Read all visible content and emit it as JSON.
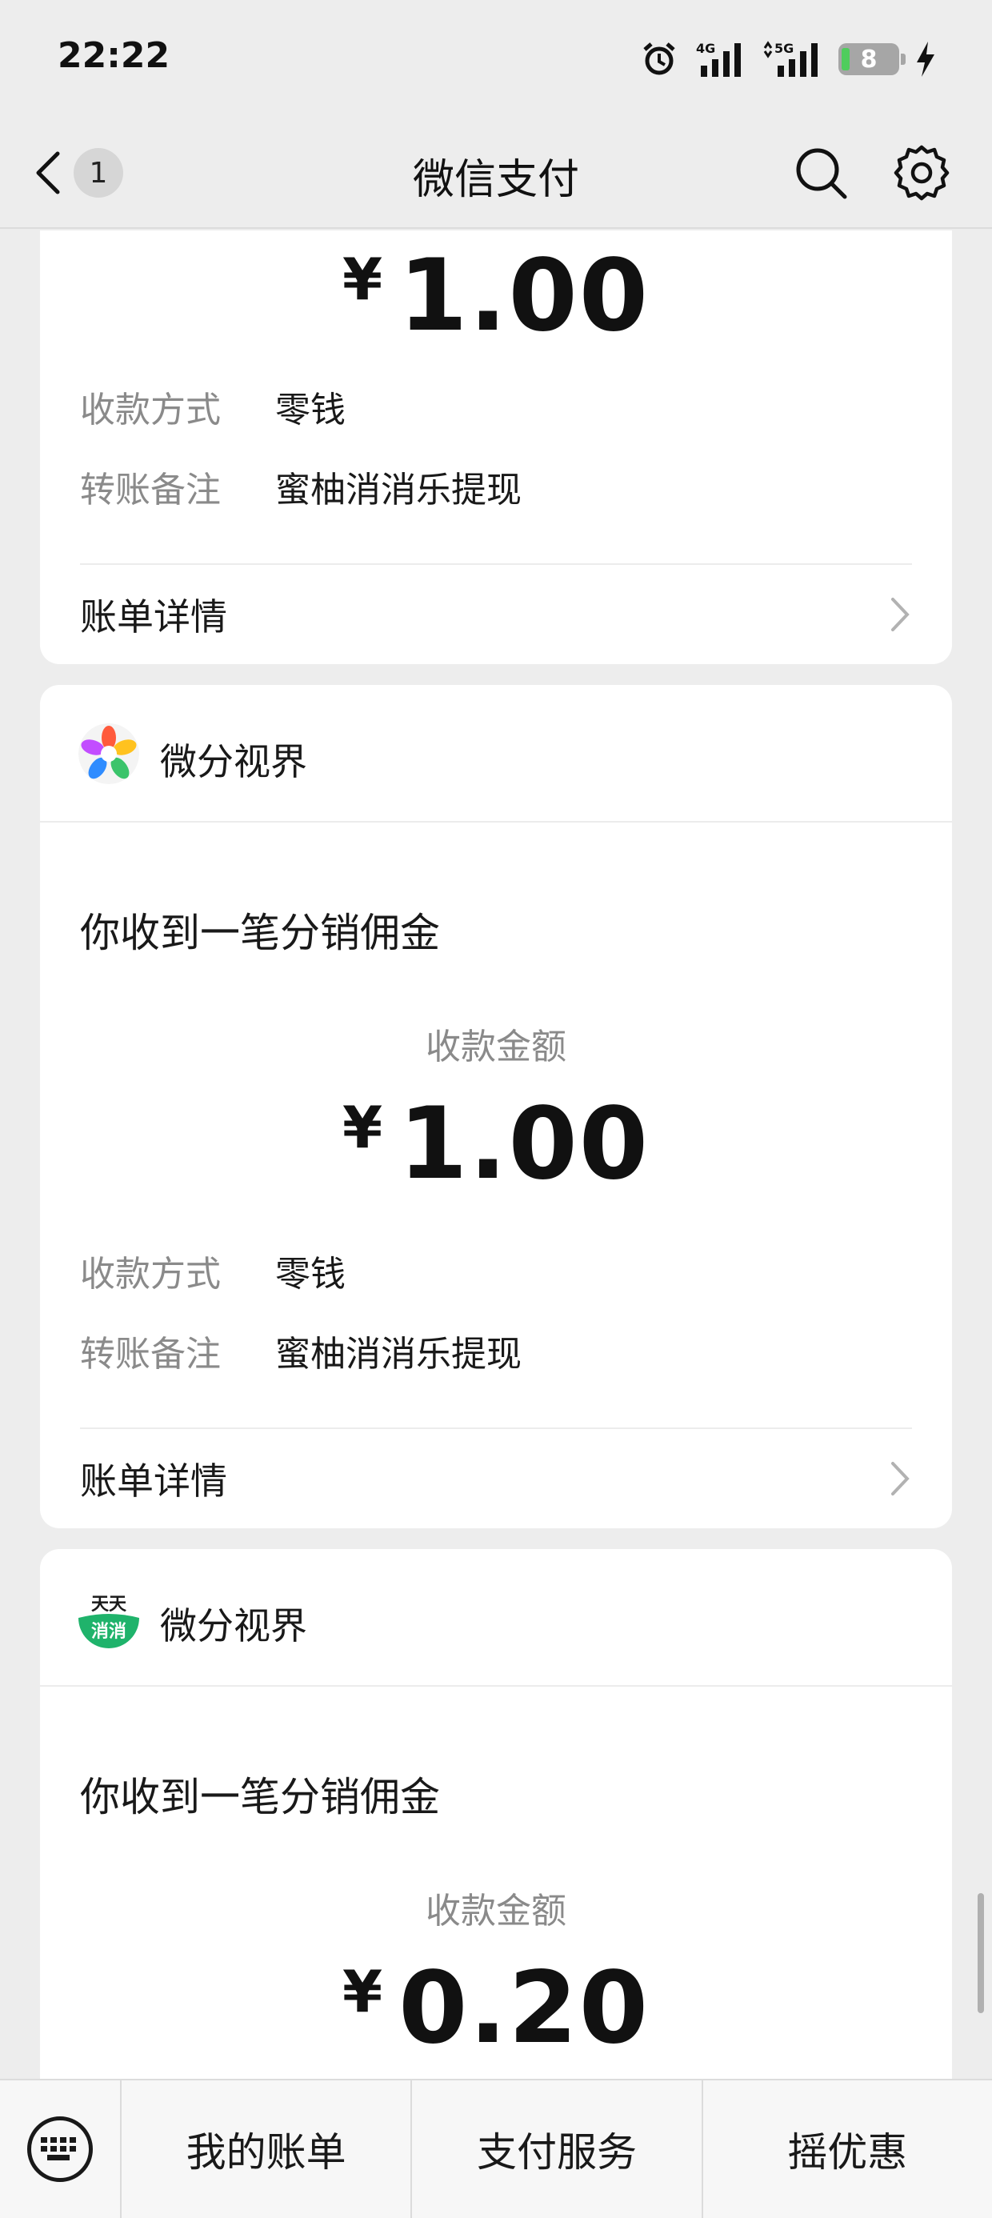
{
  "status_bar": {
    "time": "22:22",
    "battery_level": "8",
    "icons": [
      "alarm-icon",
      "signal-4g-icon",
      "signal-5g-icon",
      "battery-icon",
      "charging-icon"
    ]
  },
  "nav": {
    "back_badge": "1",
    "title": "微信支付",
    "icons": [
      "back-chevron-icon",
      "search-icon",
      "gear-icon"
    ]
  },
  "cards": [
    {
      "amount_currency": "¥",
      "amount_value": "1.00",
      "method_key": "收款方式",
      "method_val": "零钱",
      "remark_key": "转账备注",
      "remark_val": "蜜柚消消乐提现",
      "detail_label": "账单详情"
    },
    {
      "merchant": "微分视界",
      "notice": "你收到一笔分销佣金",
      "amount_label": "收款金额",
      "amount_currency": "¥",
      "amount_value": "1.00",
      "method_key": "收款方式",
      "method_val": "零钱",
      "remark_key": "转账备注",
      "remark_val": "蜜柚消消乐提现",
      "detail_label": "账单详情"
    },
    {
      "merchant": "微分视界",
      "logo_text_top": "天天",
      "logo_text_bottom": "消消",
      "notice": "你收到一笔分销佣金",
      "amount_label": "收款金额",
      "amount_currency": "¥",
      "amount_value": "0.20"
    }
  ],
  "bottom_bar": {
    "keyboard_icon": "keyboard-icon",
    "items": [
      "我的账单",
      "支付服务",
      "摇优惠"
    ]
  },
  "colors": {
    "background": "#ededed",
    "card": "#ffffff",
    "muted_text": "#8a8a8a",
    "battery_fill": "#4fcd5d"
  }
}
